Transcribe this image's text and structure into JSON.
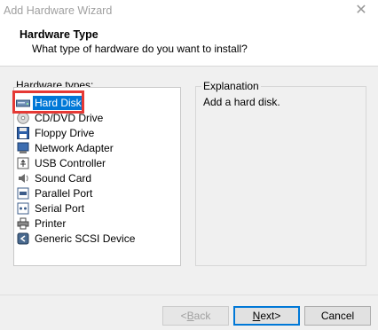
{
  "window": {
    "title": "Add Hardware Wizard",
    "close_glyph": "✕"
  },
  "header": {
    "title": "Hardware Type",
    "subtitle": "What type of hardware do you want to install?"
  },
  "hardware_types": {
    "label": "Hardware types:",
    "selected_index": 0,
    "items": [
      {
        "label": "Hard Disk",
        "icon": "hard-disk-icon"
      },
      {
        "label": "CD/DVD Drive",
        "icon": "cd-dvd-icon"
      },
      {
        "label": "Floppy Drive",
        "icon": "floppy-icon"
      },
      {
        "label": "Network Adapter",
        "icon": "network-adapter-icon"
      },
      {
        "label": "USB Controller",
        "icon": "usb-icon"
      },
      {
        "label": "Sound Card",
        "icon": "sound-card-icon"
      },
      {
        "label": "Parallel Port",
        "icon": "parallel-port-icon"
      },
      {
        "label": "Serial Port",
        "icon": "serial-port-icon"
      },
      {
        "label": "Printer",
        "icon": "printer-icon"
      },
      {
        "label": "Generic SCSI Device",
        "icon": "scsi-device-icon"
      }
    ]
  },
  "explanation": {
    "label": "Explanation",
    "text": "Add a hard disk."
  },
  "buttons": {
    "back": {
      "mnemonic": "B",
      "rest": "ack",
      "prefix": "< ",
      "enabled": false
    },
    "next": {
      "mnemonic": "N",
      "rest": "ext",
      "suffix": " >",
      "enabled": true
    },
    "cancel": {
      "label": "Cancel"
    }
  },
  "colors": {
    "accent": "#0078d7",
    "highlight": "#e53935"
  }
}
